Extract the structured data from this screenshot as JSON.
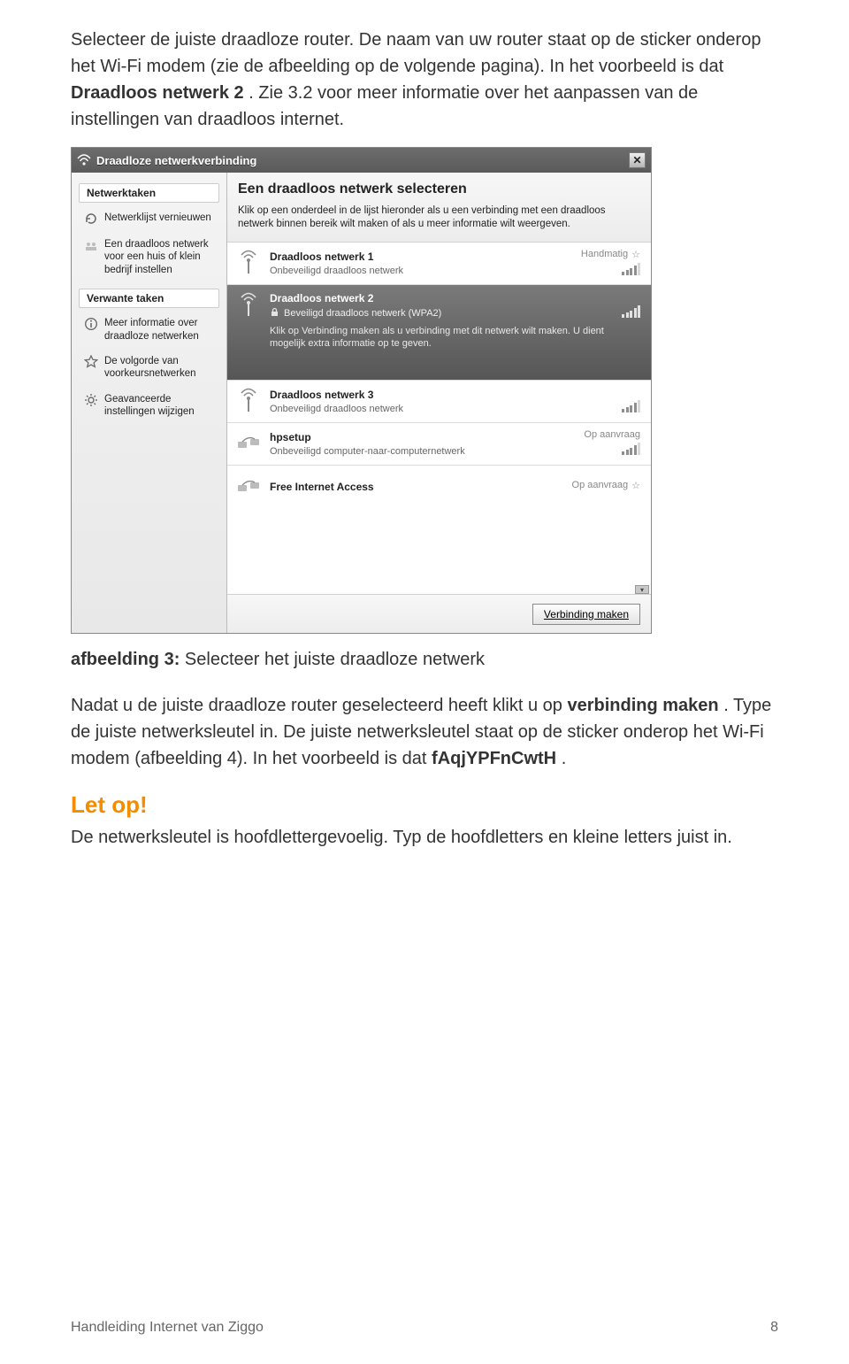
{
  "paragraphs": {
    "p1a": "Selecteer de juiste draadloze router. De naam van uw router staat op de sticker onderop het Wi-Fi modem (zie de afbeelding op de volgende pagina). In het voorbeeld is dat ",
    "p1b": "Draadloos netwerk 2",
    "p1c": ". Zie 3.2 voor meer informatie over het aanpassen van de instellingen van draadloos internet.",
    "caption_label": "afbeelding 3:",
    "caption_text": " Selecteer het juiste draadloze netwerk",
    "p2a": "Nadat u de juiste draadloze router geselecteerd heeft klikt u op ",
    "p2b": "verbinding maken",
    "p2c": ". Type de juiste netwerksleutel in. De juiste netwerksleutel staat op de sticker onderop het Wi-Fi modem (afbeelding 4). In het voorbeeld is dat ",
    "p2d": "fAqjYPFnCwtH",
    "p2e": ".",
    "letop": "Let op!",
    "p3": "De netwerksleutel is hoofdlettergevoelig. Typ de hoofdletters en kleine letters juist in."
  },
  "dialog": {
    "title": "Draadloze netwerkverbinding",
    "sidebar": {
      "head1": "Netwerktaken",
      "items1": [
        "Netwerklijst vernieuwen",
        "Een draadloos netwerk voor een huis of klein bedrijf instellen"
      ],
      "head2": "Verwante taken",
      "items2": [
        "Meer informatie over draadloze netwerken",
        "De volgorde van voorkeursnetwerken",
        "Geavanceerde instellingen wijzigen"
      ]
    },
    "main": {
      "heading": "Een draadloos netwerk selecteren",
      "intro": "Klik op een onderdeel in de lijst hieronder als u een verbinding met een draadloos netwerk binnen bereik wilt maken of als u meer informatie wilt weergeven.",
      "networks": [
        {
          "name": "Draadloos netwerk 1",
          "sub": "Onbeveiligd draadloos netwerk",
          "right": "Handmatig"
        },
        {
          "name": "Draadloos netwerk 2",
          "sub": "Beveiligd draadloos netwerk (WPA2)",
          "right": "",
          "seltext": "Klik op Verbinding maken als u verbinding met dit netwerk wilt maken. U dient mogelijk extra informatie op te geven."
        },
        {
          "name": "Draadloos netwerk 3",
          "sub": "Onbeveiligd draadloos netwerk",
          "right": ""
        },
        {
          "name": "hpsetup",
          "sub": "Onbeveiligd computer-naar-computernetwerk",
          "right": "Op aanvraag"
        },
        {
          "name": "Free Internet Access",
          "sub": "",
          "right": "Op aanvraag"
        }
      ],
      "connect_btn": "Verbinding maken"
    }
  },
  "footer": {
    "left": "Handleiding Internet van Ziggo",
    "right": "8"
  }
}
